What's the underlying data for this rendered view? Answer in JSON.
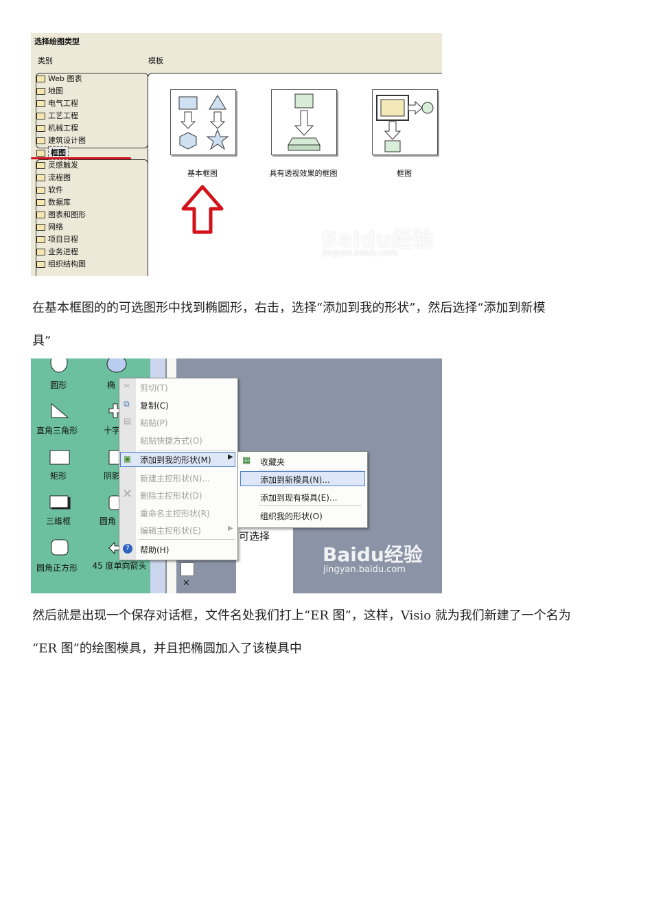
{
  "screenshot1": {
    "dialog_title": "选择绘图类型",
    "category_label": "类别",
    "template_label": "模板",
    "categories": [
      "Web 图表",
      "地图",
      "电气工程",
      "工艺工程",
      "机械工程",
      "建筑设计图",
      "框图",
      "灵感触发",
      "流程图",
      "软件",
      "数据库",
      "图表和图形",
      "网络",
      "项目日程",
      "业务进程",
      "组织结构图"
    ],
    "selected_category": "框图",
    "templates": [
      "基本框图",
      "具有透视效果的框图",
      "框图"
    ],
    "watermark": {
      "logo": "Baidu经验",
      "url": "jingyan.baidu.com"
    },
    "accent_red": "#d3111b"
  },
  "paragraph1": {
    "line1": "在基本框图的的可选图形中找到椭圆形，右击，选择“添加到我的形状”，然后选择“添加到新模",
    "line2": "具”"
  },
  "screenshot2": {
    "shapes": [
      "圆形",
      "椭",
      "直角三角形",
      "十字",
      "矩形",
      "阴影",
      "三维框",
      "圆角",
      "圆角正方形",
      "45 度单向箭头"
    ],
    "menu_items": [
      {
        "label": "剪切(T)",
        "enabled": false
      },
      {
        "label": "复制(C)",
        "enabled": true
      },
      {
        "label": "粘贴(P)",
        "enabled": false
      },
      {
        "label": "粘贴快捷方式(O)",
        "enabled": false
      },
      {
        "label": "添加到我的形状(M)",
        "enabled": true,
        "highlighted": true
      },
      {
        "label": "新建主控形状(N)...",
        "enabled": false
      },
      {
        "label": "删除主控形状(D)",
        "enabled": false
      },
      {
        "label": "重命名主控形状(R)",
        "enabled": false
      },
      {
        "label": "编辑主控形状(E)",
        "enabled": false
      },
      {
        "label": "帮助(H)",
        "enabled": true
      }
    ],
    "submenu_items": [
      {
        "label": "收藏夹"
      },
      {
        "label": "添加到新模具(N)...",
        "highlighted": true
      },
      {
        "label": "添加到现有模具(E)..."
      },
      {
        "label": "组织我的形状(O)"
      }
    ],
    "canvas_text": "可选择",
    "watermark": {
      "logo": "Baidu经验",
      "url": "jingyan.baidu.com"
    }
  },
  "paragraph2": {
    "line1": "然后就是出现一个保存对话框，文件名处我们打上“ER 图”，这样，Visio 就为我们新建了一个名为",
    "line2": "“ER 图”的绘图模具，并且把椭圆加入了该模具中"
  }
}
